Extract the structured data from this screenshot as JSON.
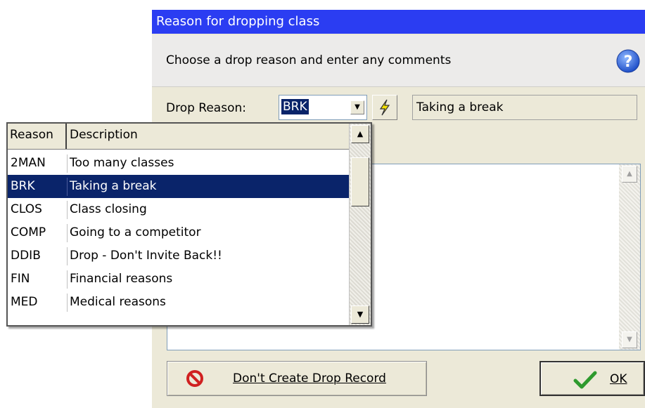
{
  "window": {
    "title": "Reason for dropping class"
  },
  "instruction": {
    "text": "Choose a drop reason and enter any comments",
    "help_icon": "question-circle-icon"
  },
  "form": {
    "drop_reason_label": "Drop Reason:",
    "drop_reason_value": "BRK",
    "description_value": "Taking a break",
    "lookup_icon": "lightning-icon"
  },
  "dropdown": {
    "headers": {
      "reason": "Reason",
      "description": "Description"
    },
    "rows": [
      {
        "code": "2MAN",
        "desc": "Too many classes",
        "selected": false
      },
      {
        "code": "BRK",
        "desc": "Taking a break",
        "selected": true
      },
      {
        "code": "CLOS",
        "desc": "Class closing",
        "selected": false
      },
      {
        "code": "COMP",
        "desc": "Going to a competitor",
        "selected": false
      },
      {
        "code": "DDIB",
        "desc": "Drop - Don't Invite Back!!",
        "selected": false
      },
      {
        "code": "FIN",
        "desc": "Financial reasons",
        "selected": false
      },
      {
        "code": "MED",
        "desc": "Medical reasons",
        "selected": false
      }
    ]
  },
  "buttons": {
    "dont_create": "Don't Create Drop Record",
    "ok": "OK"
  },
  "colors": {
    "title_bar": "#2b3df2",
    "selection": "#0a246a",
    "dialog_bg": "#ece9d8"
  }
}
